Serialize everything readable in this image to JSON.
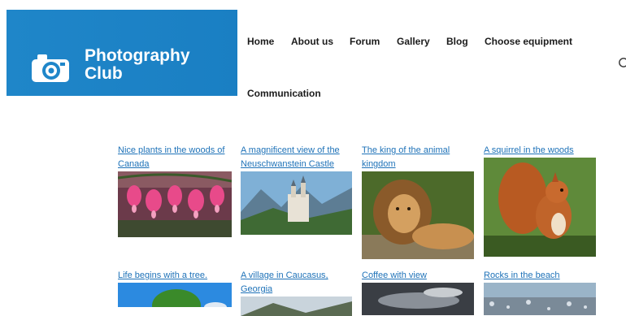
{
  "brand": {
    "title": "Photography Club",
    "icon": "camera-icon"
  },
  "nav": {
    "items": [
      {
        "label": "Home"
      },
      {
        "label": "About us"
      },
      {
        "label": "Forum"
      },
      {
        "label": "Gallery"
      },
      {
        "label": "Blog"
      },
      {
        "label": "Choose equipment"
      },
      {
        "label": "Communication"
      }
    ],
    "search_icon": "search-icon"
  },
  "gallery": {
    "items": [
      {
        "title": "Nice plants in the woods of Canada"
      },
      {
        "title": "A magnificent view of the Neuschwanstein Castle"
      },
      {
        "title": "The king of the animal kingdom"
      },
      {
        "title": "A squirrel in the woods"
      },
      {
        "title": "Life begins with a tree."
      },
      {
        "title": "A village in Caucasus, Georgia"
      },
      {
        "title": "Coffee with view"
      },
      {
        "title": "Rocks in the beach"
      }
    ]
  }
}
